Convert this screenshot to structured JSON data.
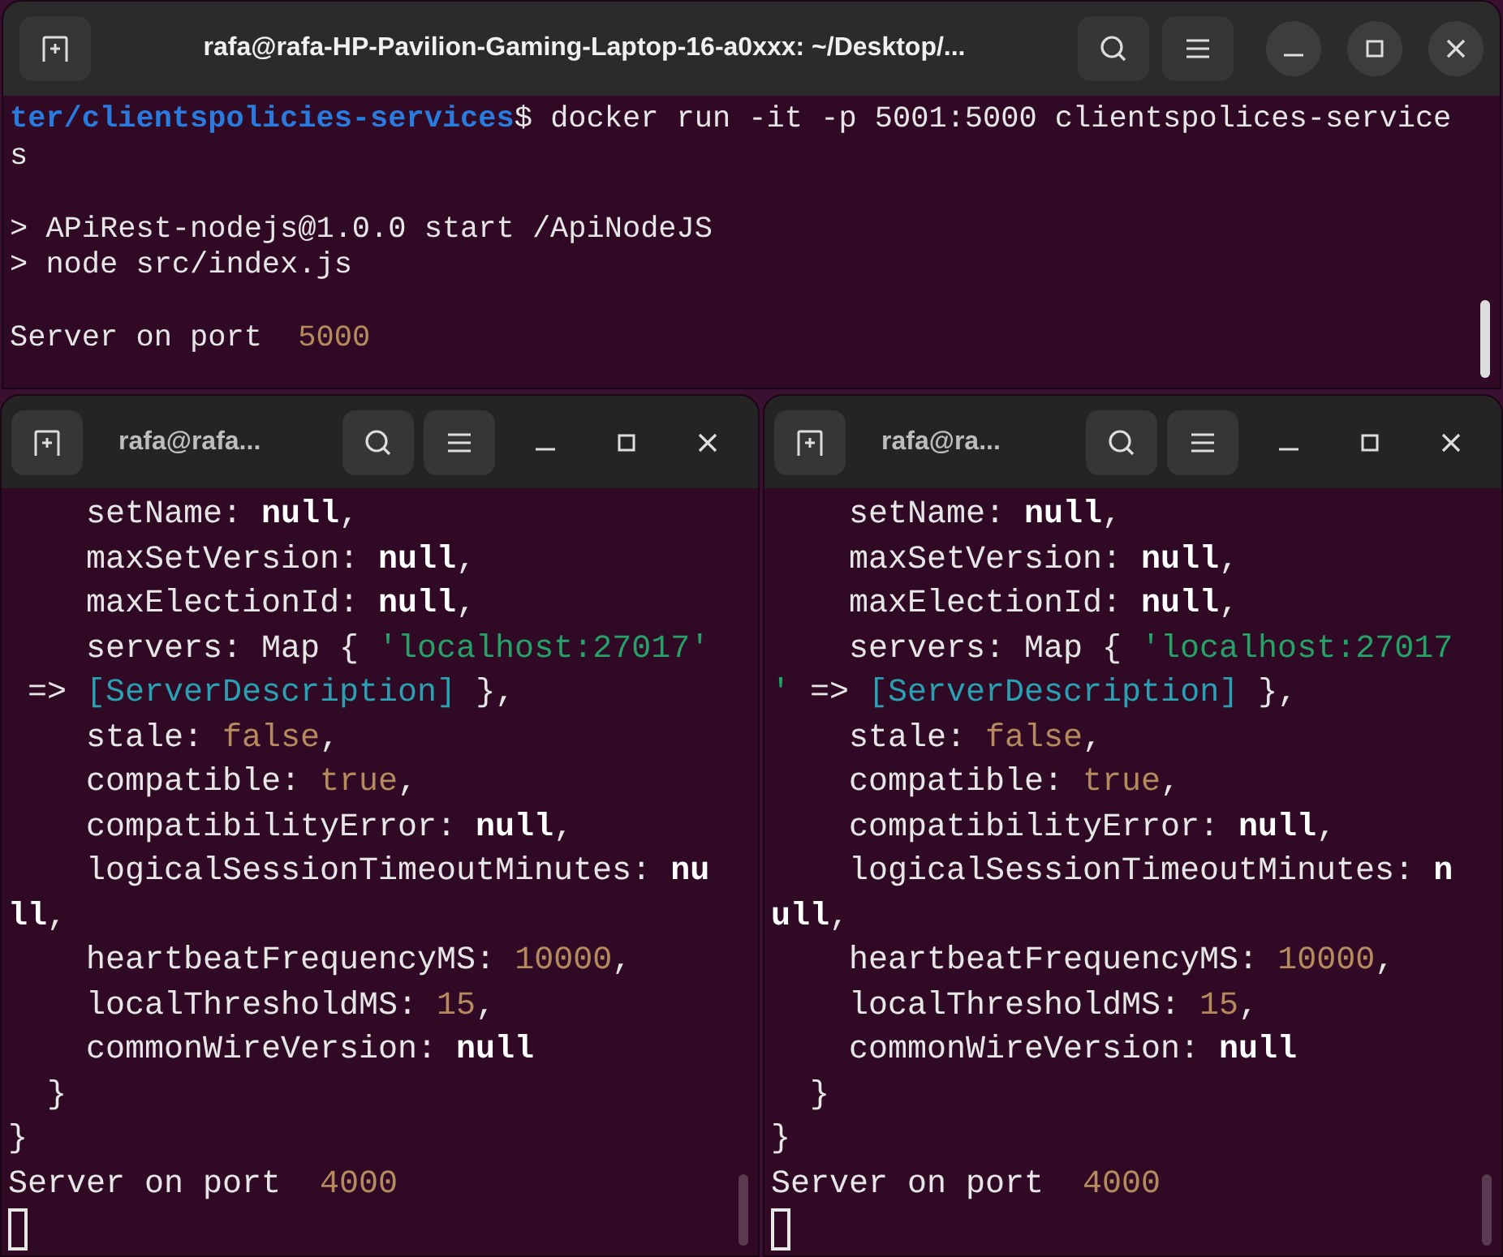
{
  "windows": [
    {
      "title": "rafa@rafa-HP-Pavilion-Gaming-Laptop-16-a0xxx: ~/Desktop/...",
      "focused": true,
      "lines": [
        [
          {
            "kind": "path",
            "text": "ter/clientspolicies-services"
          },
          {
            "kind": "plain",
            "text": "$ docker run -it -p 5001:5000 clientspolices-service"
          }
        ],
        [
          {
            "kind": "plain",
            "text": "s"
          }
        ],
        [
          {
            "kind": "blank"
          }
        ],
        [
          {
            "kind": "plain",
            "text": "> APiRest-nodejs@1.0.0 start /ApiNodeJS"
          }
        ],
        [
          {
            "kind": "plain",
            "text": "> node src/index.js"
          }
        ],
        [
          {
            "kind": "blank"
          }
        ],
        [
          {
            "kind": "plain",
            "text": "Server on port  "
          },
          {
            "kind": "number",
            "text": "5000"
          }
        ]
      ]
    },
    {
      "title": "rafa@rafa...",
      "focused": false,
      "lines": [
        [
          {
            "kind": "plain",
            "text": "    setName: "
          },
          {
            "kind": "bold",
            "text": "null"
          },
          {
            "kind": "plain",
            "text": ","
          }
        ],
        [
          {
            "kind": "plain",
            "text": "    maxSetVersion: "
          },
          {
            "kind": "bold",
            "text": "null"
          },
          {
            "kind": "plain",
            "text": ","
          }
        ],
        [
          {
            "kind": "plain",
            "text": "    maxElectionId: "
          },
          {
            "kind": "bold",
            "text": "null"
          },
          {
            "kind": "plain",
            "text": ","
          }
        ],
        [
          {
            "kind": "plain",
            "text": "    servers: Map { "
          },
          {
            "kind": "string",
            "text": "'localhost:27017'"
          }
        ],
        [
          {
            "kind": "plain",
            "text": " => "
          },
          {
            "kind": "special",
            "text": "[ServerDescription]"
          },
          {
            "kind": "plain",
            "text": " },"
          }
        ],
        [
          {
            "kind": "plain",
            "text": "    stale: "
          },
          {
            "kind": "number",
            "text": "false"
          },
          {
            "kind": "plain",
            "text": ","
          }
        ],
        [
          {
            "kind": "plain",
            "text": "    compatible: "
          },
          {
            "kind": "number",
            "text": "true"
          },
          {
            "kind": "plain",
            "text": ","
          }
        ],
        [
          {
            "kind": "plain",
            "text": "    compatibilityError: "
          },
          {
            "kind": "bold",
            "text": "null"
          },
          {
            "kind": "plain",
            "text": ","
          }
        ],
        [
          {
            "kind": "plain",
            "text": "    logicalSessionTimeoutMinutes: "
          },
          {
            "kind": "bold",
            "text": "nu"
          }
        ],
        [
          {
            "kind": "bold",
            "text": "ll"
          },
          {
            "kind": "plain",
            "text": ","
          }
        ],
        [
          {
            "kind": "plain",
            "text": "    heartbeatFrequencyMS: "
          },
          {
            "kind": "number",
            "text": "10000"
          },
          {
            "kind": "plain",
            "text": ","
          }
        ],
        [
          {
            "kind": "plain",
            "text": "    localThresholdMS: "
          },
          {
            "kind": "number",
            "text": "15"
          },
          {
            "kind": "plain",
            "text": ","
          }
        ],
        [
          {
            "kind": "plain",
            "text": "    commonWireVersion: "
          },
          {
            "kind": "bold",
            "text": "null"
          }
        ],
        [
          {
            "kind": "plain",
            "text": "  }"
          }
        ],
        [
          {
            "kind": "plain",
            "text": "}"
          }
        ],
        [
          {
            "kind": "plain",
            "text": "Server on port  "
          },
          {
            "kind": "number",
            "text": "4000"
          }
        ]
      ]
    },
    {
      "title": "rafa@ra...",
      "focused": false,
      "lines": [
        [
          {
            "kind": "plain",
            "text": "    setName: "
          },
          {
            "kind": "bold",
            "text": "null"
          },
          {
            "kind": "plain",
            "text": ","
          }
        ],
        [
          {
            "kind": "plain",
            "text": "    maxSetVersion: "
          },
          {
            "kind": "bold",
            "text": "null"
          },
          {
            "kind": "plain",
            "text": ","
          }
        ],
        [
          {
            "kind": "plain",
            "text": "    maxElectionId: "
          },
          {
            "kind": "bold",
            "text": "null"
          },
          {
            "kind": "plain",
            "text": ","
          }
        ],
        [
          {
            "kind": "plain",
            "text": "    servers: Map { "
          },
          {
            "kind": "string",
            "text": "'localhost:27017"
          }
        ],
        [
          {
            "kind": "string",
            "text": "'"
          },
          {
            "kind": "plain",
            "text": " => "
          },
          {
            "kind": "special",
            "text": "[ServerDescription]"
          },
          {
            "kind": "plain",
            "text": " },"
          }
        ],
        [
          {
            "kind": "plain",
            "text": "    stale: "
          },
          {
            "kind": "number",
            "text": "false"
          },
          {
            "kind": "plain",
            "text": ","
          }
        ],
        [
          {
            "kind": "plain",
            "text": "    compatible: "
          },
          {
            "kind": "number",
            "text": "true"
          },
          {
            "kind": "plain",
            "text": ","
          }
        ],
        [
          {
            "kind": "plain",
            "text": "    compatibilityError: "
          },
          {
            "kind": "bold",
            "text": "null"
          },
          {
            "kind": "plain",
            "text": ","
          }
        ],
        [
          {
            "kind": "plain",
            "text": "    logicalSessionTimeoutMinutes: "
          },
          {
            "kind": "bold",
            "text": "n"
          }
        ],
        [
          {
            "kind": "bold",
            "text": "ull"
          },
          {
            "kind": "plain",
            "text": ","
          }
        ],
        [
          {
            "kind": "plain",
            "text": "    heartbeatFrequencyMS: "
          },
          {
            "kind": "number",
            "text": "10000"
          },
          {
            "kind": "plain",
            "text": ","
          }
        ],
        [
          {
            "kind": "plain",
            "text": "    localThresholdMS: "
          },
          {
            "kind": "number",
            "text": "15"
          },
          {
            "kind": "plain",
            "text": ","
          }
        ],
        [
          {
            "kind": "plain",
            "text": "    commonWireVersion: "
          },
          {
            "kind": "bold",
            "text": "null"
          }
        ],
        [
          {
            "kind": "plain",
            "text": "  }"
          }
        ],
        [
          {
            "kind": "plain",
            "text": "}"
          }
        ],
        [
          {
            "kind": "plain",
            "text": "Server on port  "
          },
          {
            "kind": "number",
            "text": "4000"
          }
        ]
      ]
    }
  ]
}
